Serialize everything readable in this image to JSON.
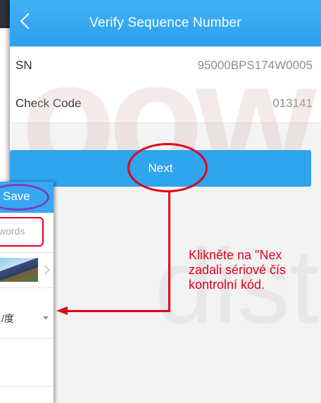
{
  "header": {
    "title": "Verify Sequence Number"
  },
  "rows": [
    {
      "label": "SN",
      "value": "95000BPS174W0005"
    },
    {
      "label": "Check Code",
      "value": "013141"
    }
  ],
  "next_button": {
    "label": "Next"
  },
  "annotation": {
    "text": "Klikněte na \"Nex\nzadali sériové čís\nkontrolní kód."
  },
  "overlay": {
    "save_label": "Save",
    "input_placeholder": "words",
    "unit_value": "/度"
  },
  "colors": {
    "primary": "#2fa4ef",
    "annotation": "#e3001b",
    "save_highlight": "#7d3bbd"
  }
}
